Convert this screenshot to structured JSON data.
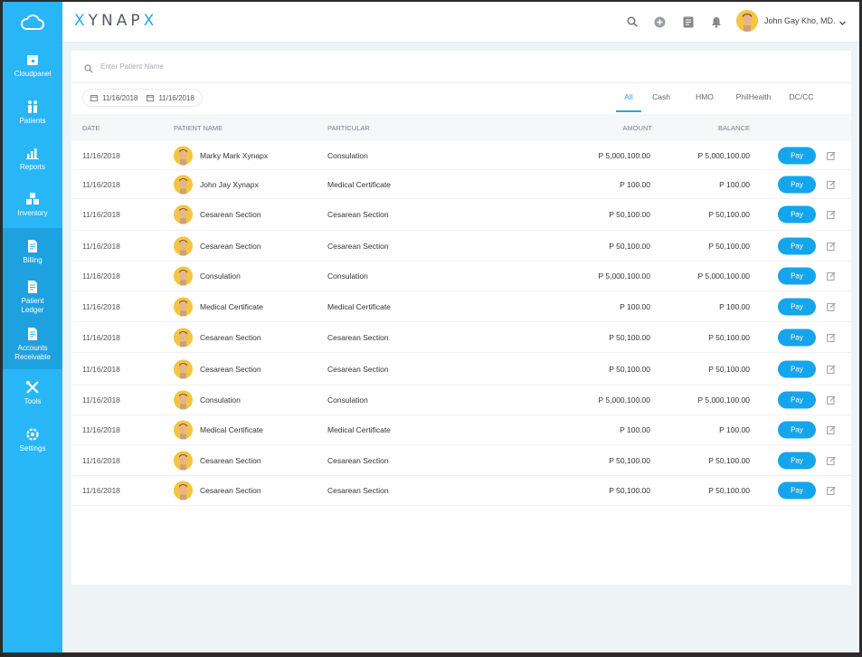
{
  "brand": {
    "name_part1": "",
    "x1": "X",
    "mid": "YNAP",
    "x2": "X"
  },
  "topbar": {
    "icons": [
      "search-icon",
      "add-circle-icon",
      "notes-icon",
      "bell-icon"
    ],
    "user_name": "John Gay Kho, MD."
  },
  "sidebar": {
    "items": [
      {
        "label": "Cloudpanel",
        "icon": "calendar-icon",
        "active": false
      },
      {
        "label": "Patients",
        "icon": "people-icon",
        "active": false
      },
      {
        "label": "Reports",
        "icon": "chart-icon",
        "active": false
      },
      {
        "label": "Inventory",
        "icon": "boxes-icon",
        "active": false
      },
      {
        "label": "Billing",
        "icon": "document-icon",
        "active": true
      },
      {
        "label": "Patient",
        "label2": "Ledger",
        "icon": "document-icon",
        "active": true
      },
      {
        "label": "Accounts",
        "label2": "Receivable",
        "icon": "document-icon",
        "active": true
      },
      {
        "label": "Tools",
        "icon": "tools-icon",
        "active": false
      },
      {
        "label": "Settings",
        "icon": "gear-icon",
        "active": false
      }
    ]
  },
  "search": {
    "placeholder": "Enter Patient Name"
  },
  "date_range": {
    "from": "11/16/2018",
    "to": "11/16/2018"
  },
  "tabs": [
    "All",
    "Cash",
    "HMO",
    "PhilHealth",
    "DC/CC"
  ],
  "active_tab": "All",
  "table": {
    "headers": {
      "date": "DATE",
      "patient": "PATIENT NAME",
      "particular": "PARTICULAR",
      "amount": "AMOUNT",
      "balance": "BALANCE"
    },
    "pay_label": "Pay",
    "rows": [
      {
        "date": "11/16/2018",
        "patient": "Marky Mark Xynapx",
        "particular": "Consulation",
        "amount": "P 5,000,100.00",
        "balance": "P 5,000,100.00"
      },
      {
        "date": "11/16/2018",
        "patient": "John Jay Xynapx",
        "particular": "Medical Certificate",
        "amount": "P 100.00",
        "balance": "P 100.00"
      },
      {
        "date": "11/16/2018",
        "patient": "Cesarean Section",
        "particular": "Cesarean Section",
        "amount": "P 50,100.00",
        "balance": "P 50,100.00"
      },
      {
        "date": "11/16/2018",
        "patient": "Cesarean Section",
        "particular": "Cesarean Section",
        "amount": "P 50,100.00",
        "balance": "P 50,100.00"
      },
      {
        "date": "11/16/2018",
        "patient": "Consulation",
        "particular": "Consulation",
        "amount": "P 5,000,100.00",
        "balance": "P 5,000,100.00"
      },
      {
        "date": "11/16/2018",
        "patient": "Medical Certificate",
        "particular": "Medical Certificate",
        "amount": "P 100.00",
        "balance": "P 100.00"
      },
      {
        "date": "11/16/2018",
        "patient": "Cesarean Section",
        "particular": "Cesarean Section",
        "amount": "P 50,100.00",
        "balance": "P 50,100.00"
      },
      {
        "date": "11/16/2018",
        "patient": "Cesarean Section",
        "particular": "Cesarean Section",
        "amount": "P 50,100.00",
        "balance": "P 50,100.00"
      },
      {
        "date": "11/16/2018",
        "patient": "Consulation",
        "particular": "Consulation",
        "amount": "P 5,000,100.00",
        "balance": "P 5,000,100.00"
      },
      {
        "date": "11/16/2018",
        "patient": "Medical Certificate",
        "particular": "Medical Certificate",
        "amount": "P 100.00",
        "balance": "P 100.00"
      },
      {
        "date": "11/16/2018",
        "patient": "Cesarean Section",
        "particular": "Cesarean Section",
        "amount": "P 50,100.00",
        "balance": "P 50,100.00"
      },
      {
        "date": "11/16/2018",
        "patient": "Cesarean Section",
        "particular": "Cesarean Section",
        "amount": "P 50,100.00",
        "balance": "P 50,100.00"
      }
    ]
  },
  "colors": {
    "accent": "#29b6f6",
    "pay": "#14a5ec",
    "brand_x": "#26a9e0"
  }
}
